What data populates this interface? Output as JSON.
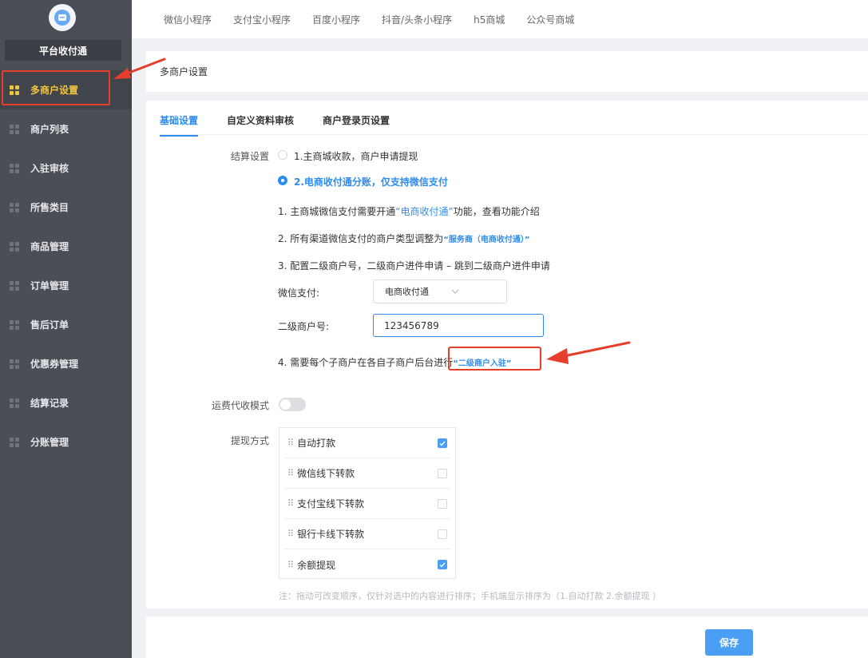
{
  "sidebar": {
    "platform": "平台收付通",
    "items": [
      {
        "label": "多商户设置"
      },
      {
        "label": "商户列表"
      },
      {
        "label": "入驻审核"
      },
      {
        "label": "所售类目"
      },
      {
        "label": "商品管理"
      },
      {
        "label": "订单管理"
      },
      {
        "label": "售后订单"
      },
      {
        "label": "优惠券管理"
      },
      {
        "label": "结算记录"
      },
      {
        "label": "分账管理"
      }
    ]
  },
  "topnav": {
    "tabs": [
      "微信小程序",
      "支付宝小程序",
      "百度小程序",
      "抖音/头条小程序",
      "h5商城",
      "公众号商城"
    ]
  },
  "page": {
    "title": "多商户设置"
  },
  "tabs": [
    "基础设置",
    "自定义资料审核",
    "商户登录页设置"
  ],
  "settlement": {
    "label": "结算设置",
    "option1": "1.主商城收款，商户申请提现",
    "option2": "2.电商收付通分账，仅支持微信支付",
    "step1_a": "1. 主商城微信支付需要开通",
    "step1_link": "“电商收付通”",
    "step1_b": "功能，查看功能介绍",
    "step2_a": "2. 所有渠道微信支付的商户类型调整为",
    "step2_link": "“服务商（电商收付通）”",
    "step3": "3. 配置二级商户号，二级商户进件申请 – 跳到二级商户进件申请",
    "wechat_pay_label": "微信支付:",
    "wechat_pay_value": "电商收付通",
    "sub_merchant_label": "二级商户号:",
    "sub_merchant_value": "123456789",
    "step4_a": "4. 需要每个子商户在各自子商户后台进行",
    "step4_link": "“二级商户入驻”"
  },
  "freight": {
    "label": "运费代收模式",
    "enabled": false
  },
  "withdraw": {
    "label": "提现方式",
    "items": [
      {
        "name": "自动打款",
        "checked": true
      },
      {
        "name": "微信线下转款",
        "checked": false
      },
      {
        "name": "支付宝线下转款",
        "checked": false
      },
      {
        "name": "银行卡线下转款",
        "checked": false
      },
      {
        "name": "余额提现",
        "checked": true
      }
    ],
    "note": "注：拖动可改变顺序，仅针对选中的内容进行排序；手机端显示排序为（1.自动打款 2.余额提现 ）"
  },
  "footer": {
    "save_label": "保存"
  },
  "colors": {
    "accent": "#2d8cf0",
    "sidebar_bg": "#4b4e55",
    "active_menu": "#f0c53f",
    "highlight": "#e53e2b"
  }
}
